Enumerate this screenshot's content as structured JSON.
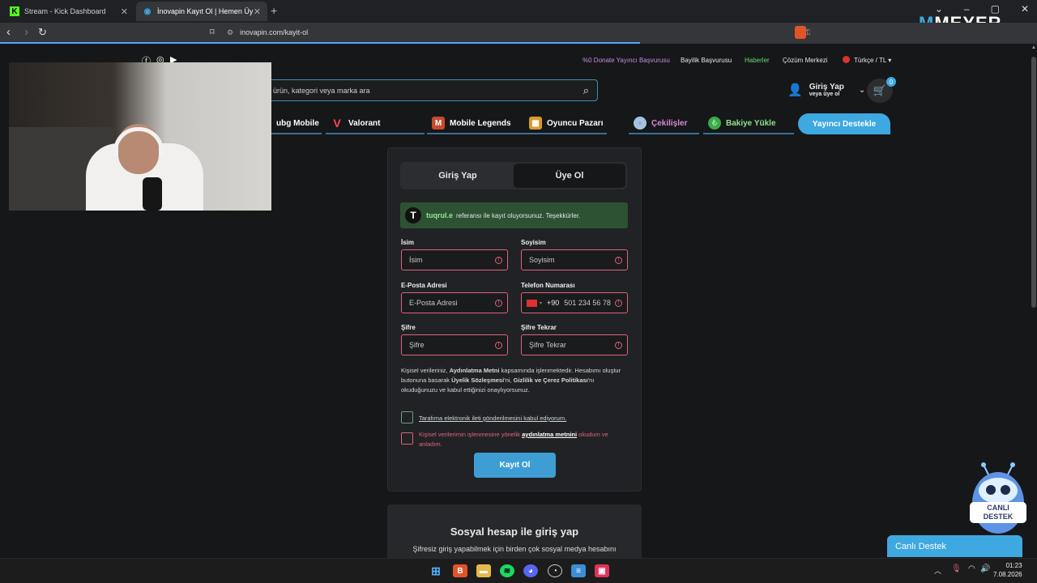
{
  "browser": {
    "tabs": [
      {
        "label": "Stream - Kick Dashboard",
        "active": false
      },
      {
        "label": "İnovapin Kayıt Ol | Hemen Üye O",
        "active": true
      }
    ],
    "url": "inovapin.com/kayit-ol"
  },
  "overlay": {
    "brand": "MEYER"
  },
  "header": {
    "top_links": [
      "%0 Donate Yayıncı Başvurusu",
      "Bayilik Başvurusu",
      "Haberler",
      "Çözüm Merkezi",
      "Türkçe / TL"
    ],
    "search_placeholder": "ürün, kategori veya marka ara",
    "login_title": "Giriş Yap",
    "login_sub": "veya üye ol",
    "cart_count": "0"
  },
  "categories": [
    "ubg Mobile",
    "Valorant",
    "Mobile Legends",
    "Oyuncu Pazarı",
    "Çekilişler",
    "Bakiye Yükle",
    "Yayıncı Destekle"
  ],
  "form": {
    "tab_login": "Giriş Yap",
    "tab_register": "Üye Ol",
    "ref_name": "tuqrul.e",
    "ref_text": "referansı ile kayıt oluyorsunuz. Teşekkürler.",
    "first_name_label": "İsim",
    "first_name_ph": "İsim",
    "last_name_label": "Soyisim",
    "last_name_ph": "Soyisim",
    "email_label": "E-Posta Adresi",
    "email_ph": "E-Posta Adresi",
    "phone_label": "Telefon Numarası",
    "phone_code": "+90",
    "phone_ph": "501 234 56 78",
    "pass_label": "Şifre",
    "pass_ph": "Şifre",
    "pass2_label": "Şifre Tekrar",
    "pass2_ph": "Şifre Tekrar",
    "legal_1": "Kişisel verileriniz, ",
    "legal_b1": "Aydınlatma Metni",
    "legal_2": " kapsamında işlenmektedir. Hesabımı oluştur butonuna basarak ",
    "legal_b2": "Üyelik Sözleşmesi",
    "legal_3": "'ni, ",
    "legal_b3": "Gizlilik ve Çerez Politikası",
    "legal_4": "'nı okuduğunuzu ve kabul ettiğinizi onaylıyorsunuz.",
    "check1": "Tarafıma elektronik ileti gönderilmesini kabul ediyorum.",
    "check2_a": "Kişisel verilerimin işlenmesine yönelik ",
    "check2_b": "aydınlatma metnini",
    "check2_c": " okudum ve anladım.",
    "submit": "Kayıt Ol"
  },
  "social": {
    "title": "Sosyal hesap ile giriş yap",
    "subtitle": "Şifresiz giriş yapabilmek için birden çok sosyal medya hesabını"
  },
  "support": {
    "label": "Canlı Destek",
    "mascot_text_1": "CANLI",
    "mascot_text_2": "DESTEK"
  },
  "taskbar": {
    "time": "01:23",
    "date": "7.08.2026"
  },
  "colors": {
    "accent": "#3ea8e0",
    "error": "#e0627b",
    "success_bg": "#2d5233"
  }
}
